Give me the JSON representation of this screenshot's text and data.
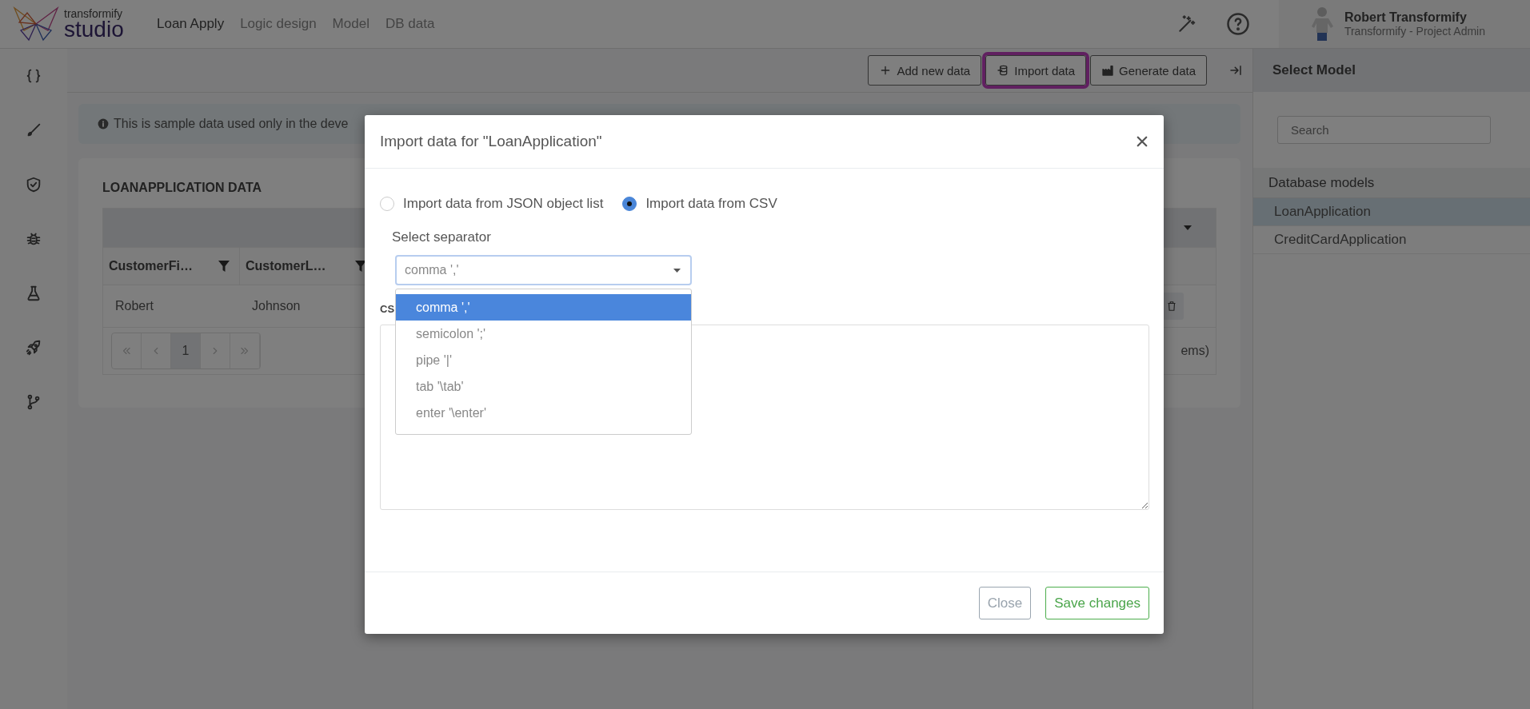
{
  "app": {
    "logo_top": "transformify",
    "logo_bottom": "studio"
  },
  "nav": [
    {
      "label": "Loan Apply",
      "selected": true
    },
    {
      "label": "Logic design",
      "selected": false
    },
    {
      "label": "Model",
      "selected": false
    },
    {
      "label": "DB data",
      "selected": false
    }
  ],
  "user": {
    "name": "Robert Transformify",
    "role": "Transformify - Project Admin"
  },
  "toolbar": {
    "buttons": [
      {
        "label": "Add new data",
        "kind": "add",
        "highlighted": false
      },
      {
        "label": "Import data",
        "kind": "import",
        "highlighted": true
      },
      {
        "label": "Generate data",
        "kind": "generate",
        "highlighted": false
      }
    ]
  },
  "notice": "This is sample data used only in the deve",
  "data_card": {
    "title": "LOANAPPLICATION DATA",
    "columns": [
      "CustomerFi…",
      "CustomerL…"
    ],
    "rows": [
      [
        "Robert",
        "Johnson"
      ]
    ],
    "pages": [
      {
        "label": "1",
        "selected": true
      }
    ],
    "items_text": "ems)"
  },
  "models_panel": {
    "title": "Select Model",
    "search": {
      "placeholder": "Search"
    },
    "group": "Database models",
    "items": [
      {
        "label": "LoanApplication",
        "selected": true
      },
      {
        "label": "CreditCardApplication",
        "selected": false
      }
    ]
  },
  "modal": {
    "title": "Import data for \"LoanApplication\"",
    "sources": [
      {
        "label": "Import data from JSON object list",
        "selected": false
      },
      {
        "label": "Import data from CSV",
        "selected": true
      }
    ],
    "separator_label": "Select separator",
    "separator": {
      "value": "comma ','",
      "expanded": true,
      "options": [
        {
          "label": "comma ','",
          "selected": true
        },
        {
          "label": "semicolon ';'",
          "selected": false
        },
        {
          "label": "pipe '|'",
          "selected": false
        },
        {
          "label": "tab '\\tab'",
          "selected": false
        },
        {
          "label": "enter '\\enter'",
          "selected": false
        }
      ]
    },
    "csv_label": "CS",
    "buttons": [
      {
        "label": "Close",
        "kind": "secondary"
      },
      {
        "label": "Save changes",
        "kind": "primary"
      }
    ]
  }
}
